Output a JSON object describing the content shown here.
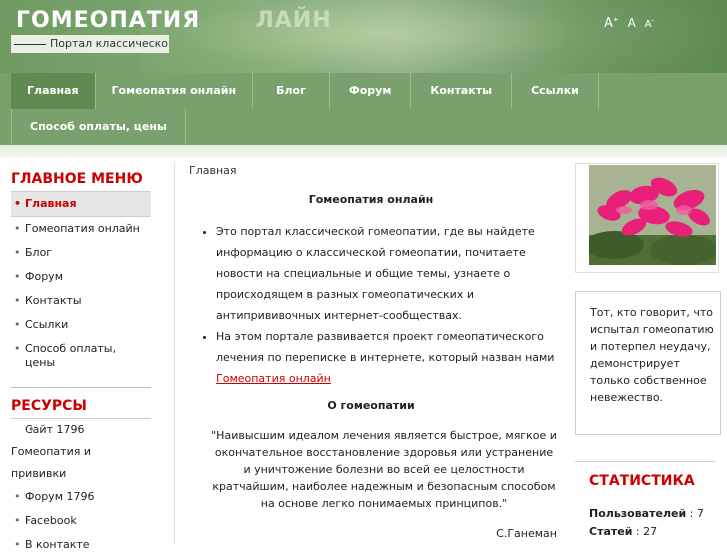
{
  "header": {
    "title_main": "ГОМЕОПАТИЯ",
    "title_fade": "ЛАЙН",
    "slogan": "Портал классической г",
    "font_controls": [
      "A+",
      "A",
      "A-"
    ]
  },
  "nav": {
    "row1": [
      "Главная",
      "Гомеопатия онлайн",
      "Блог",
      "Форум",
      "Контакты",
      "Ссылки"
    ],
    "row2": [
      "Способ оплаты, цены"
    ]
  },
  "main_menu": {
    "title": "ГЛАВНОЕ МЕНЮ",
    "items": [
      "Главная",
      "Гомеопатия онлайн",
      "Блог",
      "Форум",
      "Контакты",
      "Ссылки",
      "Способ оплаты, цены"
    ]
  },
  "resources": {
    "title": "РЕСУРСЫ",
    "items": [
      "Сайт 1796 Гомеопатия и прививки",
      "Форум 1796",
      "Facebook",
      "В контакте"
    ]
  },
  "article": {
    "breadcrumb": "Главная",
    "title": "Гомеопатия онлайн",
    "bullet1": "Это портал классической гомеопатии, где вы найдете информацию о классической гомеопатии, почитаете новости на специальные и общие темы, узнаете о происходящем в разных гомеопатических и антипрививочных интернет-сообществах.",
    "bullet2": "На этом портале развивается проект гомеопатического лечения по переписке в интернете, который назван нами",
    "bullet2_link": "Гомеопатия онлайн",
    "subtitle": "О гомеопатии",
    "quote": "\"Наивысшим идеалом лечения является быстрое, мягкое и окончательное восстановление здоровья или устранение и уничтожение болезни во всей ее целостности кратчайшим, наиболее надежным и безопасным способом на основе легко понимаемых принципов.\"",
    "author": "С.Ганеман"
  },
  "sidebar_right": {
    "quote": "Тот, кто говорит, что испытал гомеопатию и потерпел неудачу, демонстрирует только собственное невежество.",
    "stats_title": "СТАТИСТИКА",
    "stats": [
      {
        "label": "Пользователей",
        "value": "7"
      },
      {
        "label": "Статей",
        "value": "27"
      }
    ]
  },
  "colors": {
    "accent": "#cc0000",
    "nav_bg": "#7aa16d",
    "nav_active": "#5f8a52"
  }
}
